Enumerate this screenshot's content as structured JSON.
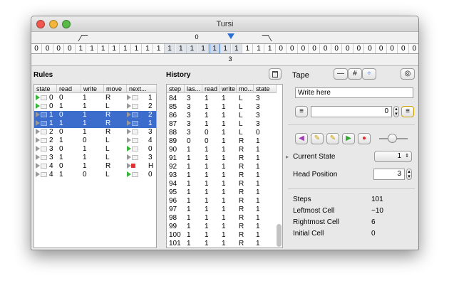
{
  "window": {
    "title": "Tursi"
  },
  "tape": {
    "index_left": "0",
    "index_head": "1",
    "index_right": "3",
    "cells": [
      "0",
      "0",
      "0",
      "0",
      "1",
      "1",
      "1",
      "1",
      "1",
      "1",
      "1",
      "1",
      "1",
      "1",
      "1",
      "1",
      "1",
      "1",
      "1",
      "1",
      "1",
      "1",
      "0",
      "0",
      "0",
      "0",
      "0",
      "0",
      "0",
      "0",
      "0",
      "0",
      "0",
      "0",
      "0"
    ],
    "head_cell": 16
  },
  "rules": {
    "title": "Rules",
    "columns": [
      "state",
      "read",
      "write",
      "move",
      "next..."
    ],
    "rows": [
      {
        "state": "0",
        "read": "0",
        "write": "1",
        "move": "R",
        "next": "1",
        "mark": "green",
        "selected": false
      },
      {
        "state": "0",
        "read": "1",
        "write": "1",
        "move": "L",
        "next": "2",
        "mark": "green",
        "selected": false
      },
      {
        "state": "1",
        "read": "0",
        "write": "1",
        "move": "R",
        "next": "2",
        "mark": "",
        "selected": true
      },
      {
        "state": "1",
        "read": "1",
        "write": "1",
        "move": "R",
        "next": "1",
        "mark": "",
        "selected": true
      },
      {
        "state": "2",
        "read": "0",
        "write": "1",
        "move": "R",
        "next": "3",
        "mark": "",
        "selected": false
      },
      {
        "state": "2",
        "read": "1",
        "write": "0",
        "move": "L",
        "next": "4",
        "mark": "",
        "selected": false
      },
      {
        "state": "3",
        "read": "0",
        "write": "1",
        "move": "L",
        "next": "0",
        "mark": "",
        "selected": false,
        "next_mark": "green"
      },
      {
        "state": "3",
        "read": "1",
        "write": "1",
        "move": "L",
        "next": "3",
        "mark": "",
        "selected": false
      },
      {
        "state": "4",
        "read": "0",
        "write": "1",
        "move": "R",
        "next": "H",
        "mark": "",
        "selected": false,
        "next_mark": "halt"
      },
      {
        "state": "4",
        "read": "1",
        "write": "0",
        "move": "L",
        "next": "0",
        "mark": "",
        "selected": false,
        "next_mark": "green"
      }
    ]
  },
  "history": {
    "title": "History",
    "columns": [
      "step",
      "las...",
      "read",
      "write",
      "mo...",
      "state"
    ],
    "rows": [
      [
        "84",
        "3",
        "1",
        "1",
        "L",
        "3"
      ],
      [
        "85",
        "3",
        "1",
        "1",
        "L",
        "3"
      ],
      [
        "86",
        "3",
        "1",
        "1",
        "L",
        "3"
      ],
      [
        "87",
        "3",
        "1",
        "1",
        "L",
        "3"
      ],
      [
        "88",
        "3",
        "0",
        "1",
        "L",
        "0"
      ],
      [
        "89",
        "0",
        "0",
        "1",
        "R",
        "1"
      ],
      [
        "90",
        "1",
        "1",
        "1",
        "R",
        "1"
      ],
      [
        "91",
        "1",
        "1",
        "1",
        "R",
        "1"
      ],
      [
        "92",
        "1",
        "1",
        "1",
        "R",
        "1"
      ],
      [
        "93",
        "1",
        "1",
        "1",
        "R",
        "1"
      ],
      [
        "94",
        "1",
        "1",
        "1",
        "R",
        "1"
      ],
      [
        "95",
        "1",
        "1",
        "1",
        "R",
        "1"
      ],
      [
        "96",
        "1",
        "1",
        "1",
        "R",
        "1"
      ],
      [
        "97",
        "1",
        "1",
        "1",
        "R",
        "1"
      ],
      [
        "98",
        "1",
        "1",
        "1",
        "R",
        "1"
      ],
      [
        "99",
        "1",
        "1",
        "1",
        "R",
        "1"
      ],
      [
        "100",
        "1",
        "1",
        "1",
        "R",
        "1"
      ],
      [
        "101",
        "1",
        "1",
        "1",
        "R",
        "1"
      ]
    ]
  },
  "tape_panel": {
    "title": "Tape",
    "text_placeholder": "Write here",
    "position_value": "0"
  },
  "state_panel": {
    "current_state_label": "Current State",
    "current_state_value": "1",
    "head_position_label": "Head Position",
    "head_position_value": "3"
  },
  "stats": {
    "steps_label": "Steps",
    "steps_value": "101",
    "leftmost_label": "Leftmost Cell",
    "leftmost_value": "−10",
    "rightmost_label": "Rightmost Cell",
    "rightmost_value": "6",
    "initial_label": "Initial Cell",
    "initial_value": "0"
  }
}
